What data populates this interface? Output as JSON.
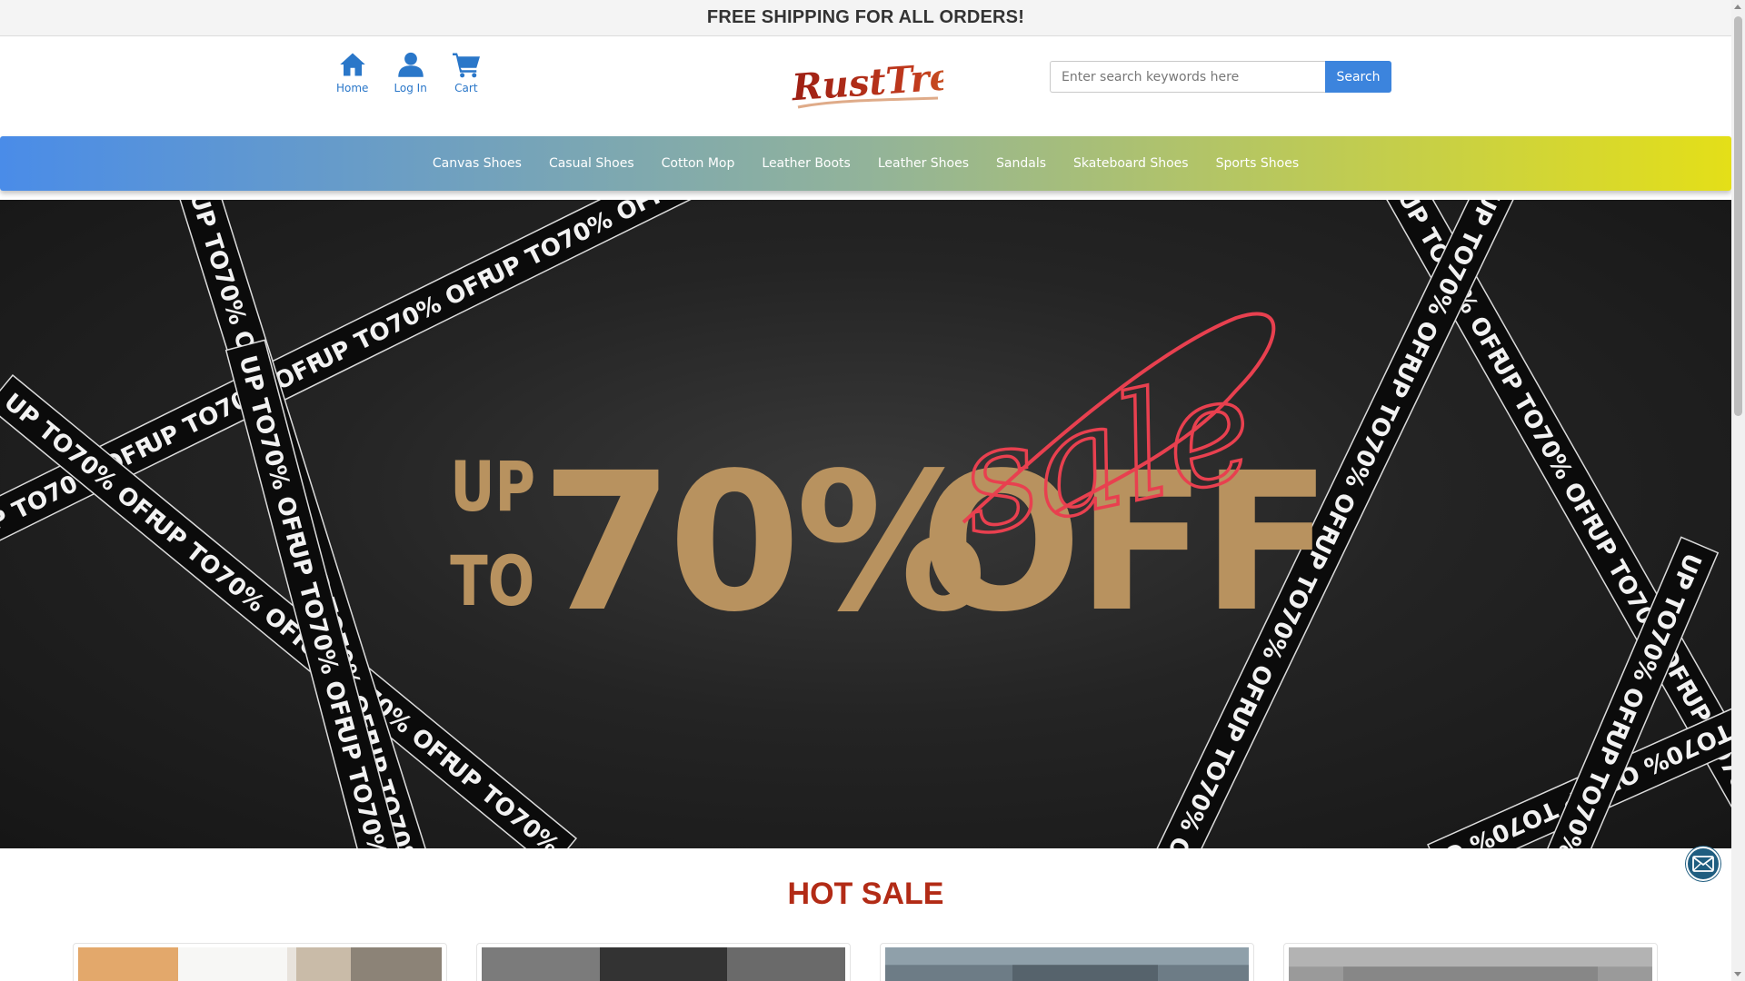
{
  "announcement": "FREE SHIPPING FOR ALL ORDERS!",
  "header": {
    "quicknav": [
      {
        "label": "Home",
        "icon": "home-icon"
      },
      {
        "label": "Log In",
        "icon": "user-icon"
      },
      {
        "label": "Cart",
        "icon": "cart-icon"
      }
    ],
    "logo_text": "RustTread",
    "search": {
      "placeholder": "Enter search keywords here",
      "value": "",
      "button_label": "Search"
    }
  },
  "categories": [
    "Canvas Shoes",
    "Casual Shoes",
    "Cotton Mop",
    "Leather Boots",
    "Leather Shoes",
    "Sandals",
    "Skateboard Shoes",
    "Sports Shoes"
  ],
  "banner": {
    "headline_up": "UP",
    "headline_to": "TO",
    "headline_pct": "70%",
    "headline_off": "OFF",
    "script_word": "sale",
    "ribbon_text": "UP TO70% OFF"
  },
  "hot_sale": {
    "title": "HOT SALE",
    "product_count": 4
  },
  "colors": {
    "accent_blue": "#2a77c9",
    "search_button": "#3c84dd",
    "nav_gradient_start": "#4a8ce8",
    "nav_gradient_end": "#e4df18",
    "headline_gold": "#b8925f",
    "script_red": "#e8404f",
    "hot_sale_red": "#b22b16",
    "logo_red": "#b0271a"
  },
  "floating": {
    "icon": "mail-icon"
  }
}
